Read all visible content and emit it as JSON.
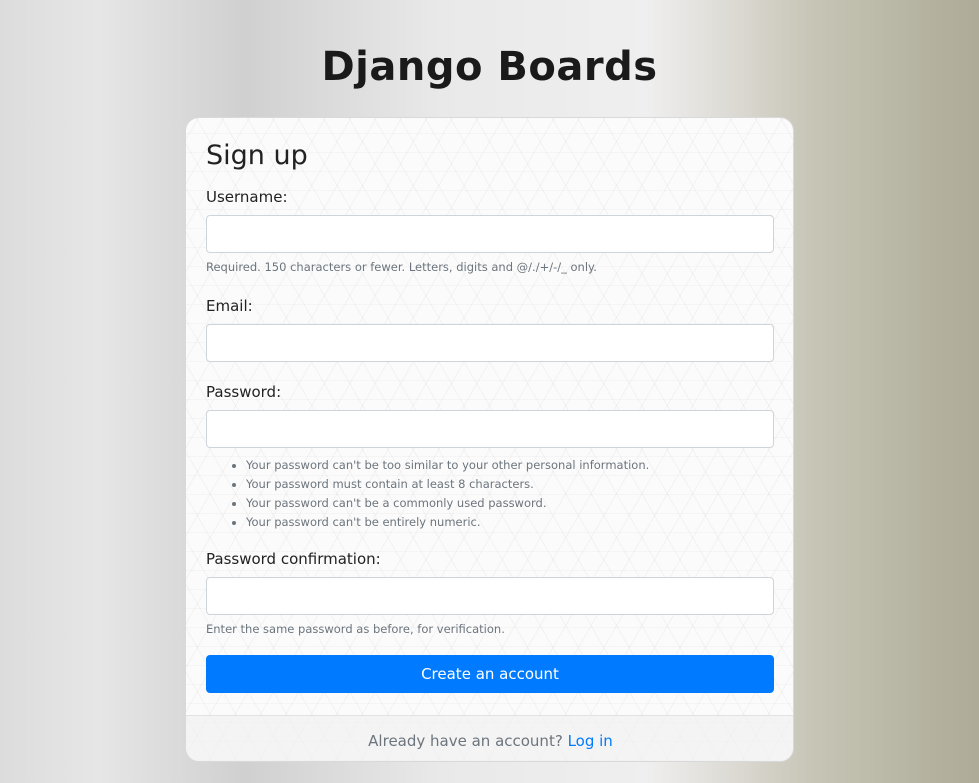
{
  "brand": "Django Boards",
  "form": {
    "title": "Sign up",
    "username": {
      "label": "Username:",
      "value": "",
      "help": "Required. 150 characters or fewer. Letters, digits and @/./+/-/_ only."
    },
    "email": {
      "label": "Email:",
      "value": ""
    },
    "password": {
      "label": "Password:",
      "value": "",
      "help_items": [
        "Your password can't be too similar to your other personal information.",
        "Your password must contain at least 8 characters.",
        "Your password can't be a commonly used password.",
        "Your password can't be entirely numeric."
      ]
    },
    "password_confirmation": {
      "label": "Password confirmation:",
      "value": "",
      "help": "Enter the same password as before, for verification."
    },
    "submit_label": "Create an account"
  },
  "footer": {
    "text": "Already have an account?",
    "link_label": "Log in"
  },
  "colors": {
    "primary": "#007bff",
    "muted_text": "#6c757d"
  }
}
